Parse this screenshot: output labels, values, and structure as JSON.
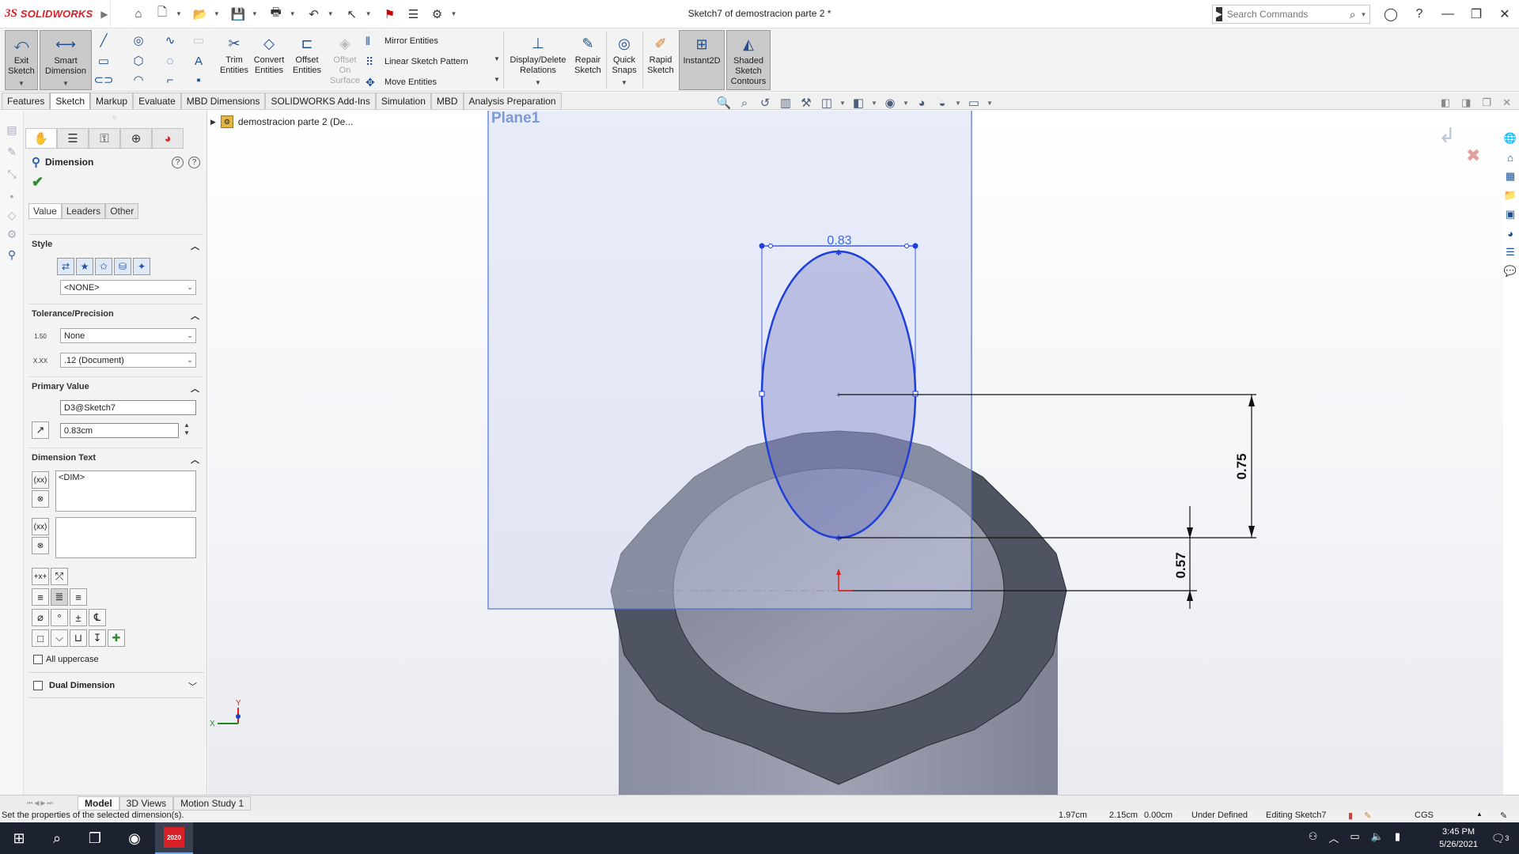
{
  "app": {
    "brand_ds": "3S",
    "brand_name": "SOLIDWORKS",
    "document_title": "Sketch7 of demostracion parte 2 *",
    "search_placeholder": "Search Commands"
  },
  "commands": {
    "exit_sketch": "Exit Sketch",
    "smart_dimension": "Smart Dimension",
    "trim_entities": "Trim Entities",
    "convert_entities": "Convert Entities",
    "offset_entities": "Offset Entities",
    "offset_on_surface": "Offset On Surface",
    "mirror_entities": "Mirror Entities",
    "linear_sketch_pattern": "Linear Sketch Pattern",
    "move_entities": "Move Entities",
    "display_delete_relations": "Display/Delete Relations",
    "repair_sketch": "Repair Sketch",
    "quick_snaps": "Quick Snaps",
    "rapid_sketch": "Rapid Sketch",
    "instant2d": "Instant2D",
    "shaded_sketch_contours": "Shaded Sketch Contours"
  },
  "tabs": [
    "Features",
    "Sketch",
    "Markup",
    "Evaluate",
    "MBD Dimensions",
    "SOLIDWORKS Add-Ins",
    "Simulation",
    "MBD",
    "Analysis Preparation"
  ],
  "active_tab": "Sketch",
  "property_manager": {
    "title": "Dimension",
    "subtabs": [
      "Value",
      "Leaders",
      "Other"
    ],
    "style": {
      "header": "Style",
      "selected": "<NONE>"
    },
    "tolerance": {
      "header": "Tolerance/Precision",
      "tolerance_type": "None",
      "precision": ".12 (Document)",
      "tol_icon_text": "1.50",
      "prec_icon_text": "X.XX"
    },
    "primary_value": {
      "header": "Primary Value",
      "name": "D3@Sketch7",
      "value": "0.83cm"
    },
    "dimension_text": {
      "header": "Dimension Text",
      "text": "<DIM>"
    },
    "all_uppercase": "All uppercase",
    "dual_dimension": "Dual Dimension"
  },
  "tree": {
    "part_name": "demostracion parte 2  (De..."
  },
  "sketch": {
    "plane_label": "Plane1",
    "dim_width": "0.83",
    "dim_vertical_upper": "0.75",
    "dim_vertical_lower": "0.57",
    "triad_y": "Y",
    "triad_x": "X"
  },
  "bottom_tabs": [
    "Model",
    "3D Views",
    "Motion Study 1"
  ],
  "active_bottom_tab": "Model",
  "status": {
    "message": "Set the properties of the selected dimension(s).",
    "coord_x": "1.97cm",
    "coord_y": "2.15cm",
    "coord_z": "0.00cm",
    "state": "Under Defined",
    "editing": "Editing Sketch7",
    "units": "CGS"
  },
  "taskbar": {
    "time": "3:45 PM",
    "date": "5/26/2021",
    "notif_count": "3",
    "sw_badge": "2020"
  },
  "colors": {
    "sketch_blue": "#1f3fd9",
    "plane_fill": "#d8dcf0",
    "tube_dark": "#505563",
    "brand_red": "#d71f26"
  }
}
